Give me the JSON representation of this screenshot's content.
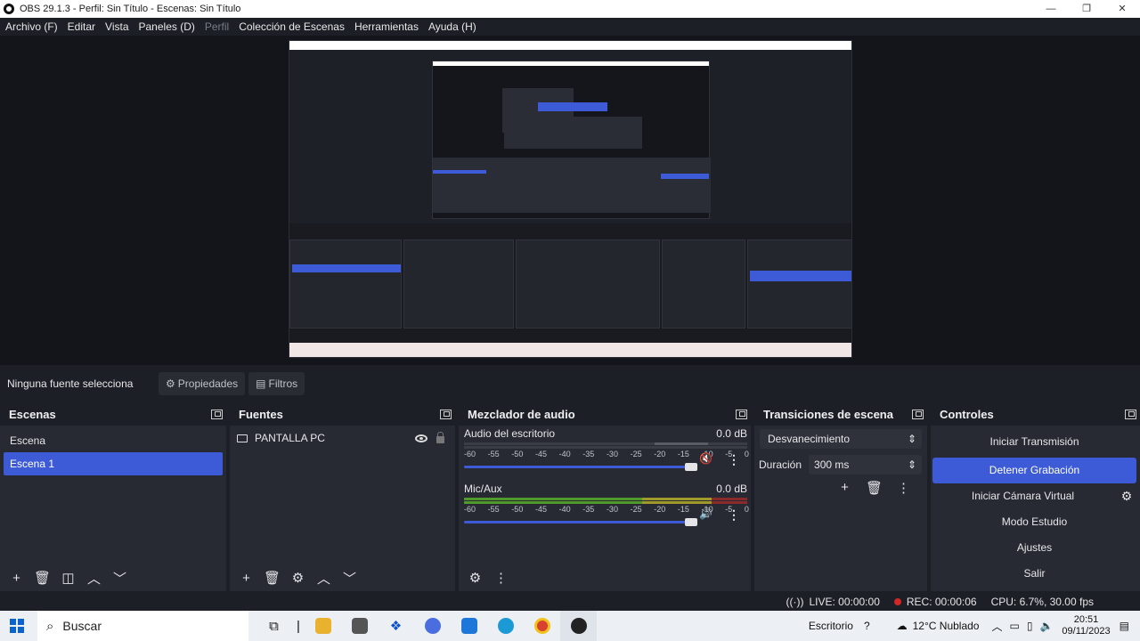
{
  "window": {
    "title": "OBS 29.1.3 - Perfil: Sin Título - Escenas: Sin Título",
    "controls": [
      "—",
      "❐",
      "✕"
    ]
  },
  "menu": [
    {
      "label": "Archivo (F)",
      "disabled": false
    },
    {
      "label": "Editar",
      "disabled": false
    },
    {
      "label": "Vista",
      "disabled": false
    },
    {
      "label": "Paneles (D)",
      "disabled": false
    },
    {
      "label": "Perfil",
      "disabled": true
    },
    {
      "label": "Colección de Escenas",
      "disabled": false
    },
    {
      "label": "Herramientas",
      "disabled": false
    },
    {
      "label": "Ayuda (H)",
      "disabled": false
    }
  ],
  "context": {
    "label": "Ninguna fuente selecciona",
    "properties": "Propiedades",
    "filters": "Filtros"
  },
  "scenes": {
    "title": "Escenas",
    "items": [
      "Escena",
      "Escena 1"
    ],
    "selected_index": 1
  },
  "sources": {
    "title": "Fuentes",
    "items": [
      {
        "name": "PANTALLA PC",
        "visible": true,
        "locked": true
      }
    ]
  },
  "mixer": {
    "title": "Mezclador de audio",
    "scale": [
      "-60",
      "-55",
      "-50",
      "-45",
      "-40",
      "-35",
      "-30",
      "-25",
      "-20",
      "-15",
      "-10",
      "-5",
      "0"
    ],
    "channels": [
      {
        "name": "Audio del escritorio",
        "level": "0.0 dB",
        "muted": true,
        "volume_fraction": 1.0
      },
      {
        "name": "Mic/Aux",
        "level": "0.0 dB",
        "muted": false,
        "volume_fraction": 1.0
      }
    ]
  },
  "transitions": {
    "title": "Transiciones de escena",
    "type": "Desvanecimiento",
    "duration_label": "Duración",
    "duration": "300 ms"
  },
  "controls": {
    "title": "Controles",
    "start_stream": "Iniciar Transmisión",
    "stop_recording": "Detener Grabación",
    "virtual_cam": "Iniciar Cámara Virtual",
    "studio_mode": "Modo Estudio",
    "settings": "Ajustes",
    "exit": "Salir"
  },
  "status": {
    "live": "LIVE: 00:00:00",
    "rec": "REC: 00:00:06",
    "cpu": "CPU: 6.7%, 30.00 fps"
  },
  "taskbar": {
    "search": "Buscar",
    "desktop": "Escritorio",
    "weather": "12°C Nublado",
    "time": "20:51",
    "date": "09/11/2023"
  },
  "colors": {
    "accent": "#3d5bd7",
    "bg": "#1d1f26",
    "dock": "#272a33",
    "rec": "#d32626"
  }
}
